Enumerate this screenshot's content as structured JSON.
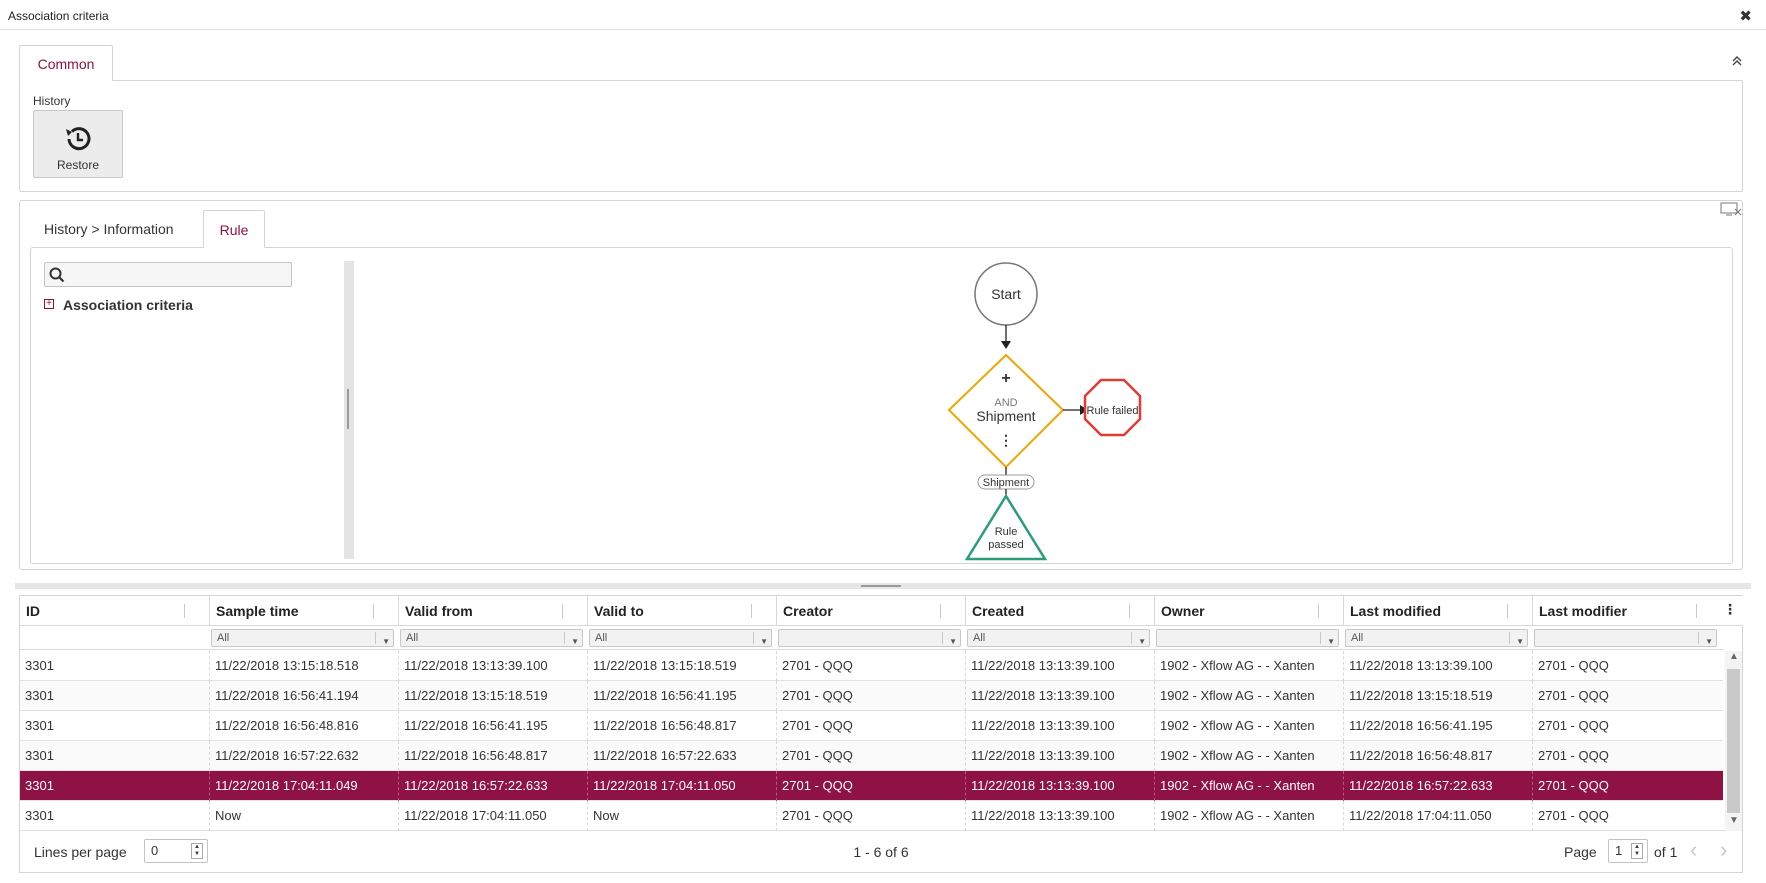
{
  "window": {
    "title": "Association criteria",
    "close": "✖"
  },
  "common": {
    "tab_label": "Common",
    "collapse_icon": "⌃",
    "history_label": "History",
    "restore_label": "Restore"
  },
  "history_panel": {
    "tabs": [
      {
        "label": "History > Information",
        "active": false
      },
      {
        "label": "Rule",
        "active": true
      }
    ],
    "search": {
      "placeholder": "",
      "value": ""
    },
    "tree": {
      "expand_icon": "+",
      "root_label": "Association criteria"
    }
  },
  "diagram": {
    "start_label": "Start",
    "node_plus": "+",
    "node_operator": "AND",
    "node_label": "Shipment",
    "node_more": "⋮",
    "failed_label": "Rule failed",
    "edge_label": "Shipment",
    "passed_label_line1": "Rule",
    "passed_label_line2": "passed"
  },
  "grid": {
    "columns": [
      "ID",
      "Sample time",
      "Valid from",
      "Valid to",
      "Creator",
      "Created",
      "Owner",
      "Last modified",
      "Last modifier"
    ],
    "menu_icon": "⋮",
    "filters": [
      "",
      "All",
      "All",
      "All",
      "",
      "All",
      "",
      "All",
      ""
    ],
    "rows": [
      [
        "3301",
        "11/22/2018 13:15:18.518",
        "11/22/2018 13:13:39.100",
        "11/22/2018 13:15:18.519",
        "2701 - QQQ",
        "11/22/2018 13:13:39.100",
        "1902 - Xflow AG - - Xanten",
        "11/22/2018 13:13:39.100",
        "2701 - QQQ"
      ],
      [
        "3301",
        "11/22/2018 16:56:41.194",
        "11/22/2018 13:15:18.519",
        "11/22/2018 16:56:41.195",
        "2701 - QQQ",
        "11/22/2018 13:13:39.100",
        "1902 - Xflow AG - - Xanten",
        "11/22/2018 13:15:18.519",
        "2701 - QQQ"
      ],
      [
        "3301",
        "11/22/2018 16:56:48.816",
        "11/22/2018 16:56:41.195",
        "11/22/2018 16:56:48.817",
        "2701 - QQQ",
        "11/22/2018 13:13:39.100",
        "1902 - Xflow AG - - Xanten",
        "11/22/2018 16:56:41.195",
        "2701 - QQQ"
      ],
      [
        "3301",
        "11/22/2018 16:57:22.632",
        "11/22/2018 16:56:48.817",
        "11/22/2018 16:57:22.633",
        "2701 - QQQ",
        "11/22/2018 13:13:39.100",
        "1902 - Xflow AG - - Xanten",
        "11/22/2018 16:56:48.817",
        "2701 - QQQ"
      ],
      [
        "3301",
        "11/22/2018 17:04:11.049",
        "11/22/2018 16:57:22.633",
        "11/22/2018 17:04:11.050",
        "2701 - QQQ",
        "11/22/2018 13:13:39.100",
        "1902 - Xflow AG - - Xanten",
        "11/22/2018 16:57:22.633",
        "2701 - QQQ"
      ],
      [
        "3301",
        "Now",
        "11/22/2018 17:04:11.050",
        "Now",
        "2701 - QQQ",
        "11/22/2018 13:13:39.100",
        "1902 - Xflow AG - - Xanten",
        "11/22/2018 17:04:11.050",
        "2701 - QQQ"
      ]
    ],
    "selected_row": 4
  },
  "pager": {
    "lines_per_page_label": "Lines per page",
    "lines_per_page_value": "0",
    "count_text": "1 - 6 of 6",
    "page_label": "Page",
    "page_value": "1",
    "of_label": "of 1",
    "prev_icon": "‹",
    "next_icon": "›"
  },
  "colors": {
    "accent": "#8e1244",
    "node_orange": "#f0a500",
    "failed_red": "#e03c31",
    "passed_green": "#2a9d7a"
  }
}
